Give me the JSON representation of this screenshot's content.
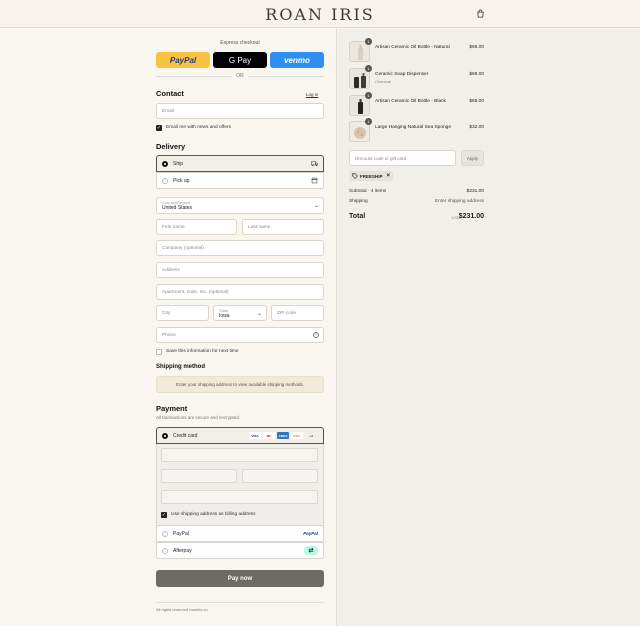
{
  "brand": "ROAN IRIS",
  "express": {
    "label": "Express checkout",
    "paypal": "PayPal",
    "gpay": "G Pay",
    "venmo": "venmo",
    "or": "OR"
  },
  "contact": {
    "title": "Contact",
    "login": "Log in",
    "email_placeholder": "Email",
    "newsletter": "Email me with news and offers"
  },
  "delivery": {
    "title": "Delivery",
    "ship": "Ship",
    "pickup": "Pick up",
    "country_label": "Country/Region",
    "country_value": "United States",
    "first_name": "First name",
    "last_name": "Last name",
    "company": "Company (optional)",
    "address": "Address",
    "apartment": "Apartment, suite, etc. (optional)",
    "city": "City",
    "state_label": "State",
    "state_value": "Iowa",
    "zip": "ZIP code",
    "phone": "Phone",
    "save_info": "Save this information for next time"
  },
  "shipping": {
    "title": "Shipping method",
    "notice": "Enter your shipping address to view available shipping methods."
  },
  "payment": {
    "title": "Payment",
    "subtitle": "All transactions are secure and encrypted.",
    "credit_card": "Credit card",
    "billing_same": "Use shipping address as billing address",
    "paypal": "PayPal",
    "afterpay": "Afterpay",
    "card_logos": [
      "VISA",
      "MC",
      "AMEX",
      "DISC",
      "+4"
    ],
    "paypal_logo": "PayPal"
  },
  "pay_now": "Pay now",
  "footer": "All rights reserved roaniris.co",
  "cart": {
    "items": [
      {
        "qty": "1",
        "name": "Artisan Ceramic Oil Bottle - Natural",
        "variant": "",
        "price": "$65.00"
      },
      {
        "qty": "1",
        "name": "Ceramic Soap Dispenser",
        "variant": "Charcoal",
        "price": "$69.00"
      },
      {
        "qty": "1",
        "name": "Artisan Ceramic Oil Bottle - Black",
        "variant": "",
        "price": "$65.00"
      },
      {
        "qty": "1",
        "name": "Large Hanging Natural Sea Sponge",
        "variant": "",
        "price": "$32.00"
      }
    ],
    "discount_placeholder": "Discount code or gift card",
    "apply": "Apply",
    "code": "FREESHIP",
    "subtotal_label": "Subtotal · 4 items",
    "subtotal_value": "$231.00",
    "shipping_label": "Shipping",
    "shipping_value": "Enter shipping address",
    "total_label": "Total",
    "currency": "USD",
    "total_value": "$231.00"
  },
  "colors": {
    "paypal_bg": "#f7c340",
    "venmo_bg": "#2f8ff0",
    "pay_now_bg": "#6e6c62",
    "notice_bg": "#f2ead9"
  }
}
